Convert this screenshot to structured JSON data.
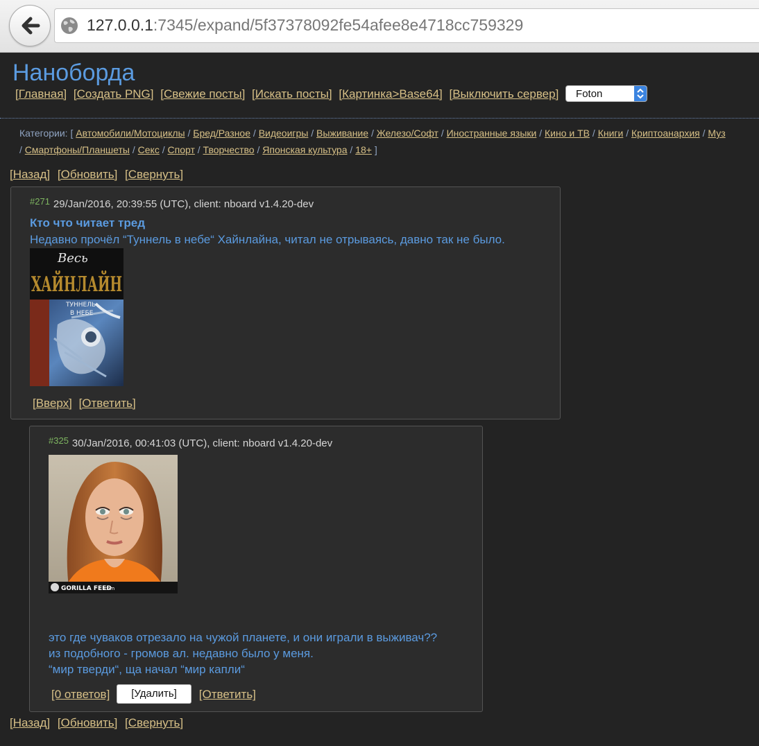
{
  "browser": {
    "url_host": "127.0.0.1",
    "url_rest": ":7345/expand/5f37378092fe54afee8e4718cc759329"
  },
  "site": {
    "title": "Нанoборда",
    "nav": [
      "[Главная]",
      "[Создать PNG]",
      "[Свежие посты]",
      "[Искать посты]",
      "[Картинка>Base64]",
      "[Выключить сервер]"
    ],
    "theme_select": "Foton"
  },
  "categories": {
    "label": "Категории:",
    "open": "[",
    "close": "]",
    "separator": "/",
    "row1": [
      "Автомобили/Мотоциклы",
      "Бред/Разное",
      "Видеоигры",
      "Выживание",
      "Железо/Софт",
      "Иностранные языки",
      "Кино и ТВ",
      "Книги",
      "Криптоанархия",
      "Муз"
    ],
    "row2": [
      "Смартфоны/Планшеты",
      "Секс",
      "Спорт",
      "Творчество",
      "Японская культура",
      "18+"
    ]
  },
  "toolbar": {
    "back": "[Назад]",
    "refresh": "[Обновить]",
    "collapse": "[Свернуть]"
  },
  "posts": [
    {
      "num": "#271",
      "meta": "29/Jan/2016, 20:39:55 (UTC), client: nboard v1.4.20-dev",
      "subject": "Кто что читает тред",
      "text": [
        "Недавно прочёл “Туннель в небе“ Хайнлайна, читал не отрываясь, давно так не было."
      ],
      "image": {
        "series": "Весь",
        "author": "ХАЙНЛАЙН",
        "title_line1": "ТУННЕЛЬ",
        "title_line2": "В НЕБЕ"
      },
      "actions": [
        "[Вверх]",
        "[Ответить]"
      ]
    },
    {
      "num": "#325",
      "meta": "30/Jan/2016, 00:41:03 (UTC), client: nboard v1.4.20-dev",
      "image": {
        "watermark": "GORILLA FEED",
        "watermark_suffix": ".com"
      },
      "text": [
        "это где чуваков отрезало на чужой планете, и они играли в выживач??",
        "из подобного - громов ал. недавно было у меня.",
        "“мир тверди“, ща начал “мир капли“"
      ],
      "actions": {
        "replies": "[0 ответов]",
        "delete": "[Удалить]",
        "reply": "[Ответить]"
      }
    }
  ]
}
